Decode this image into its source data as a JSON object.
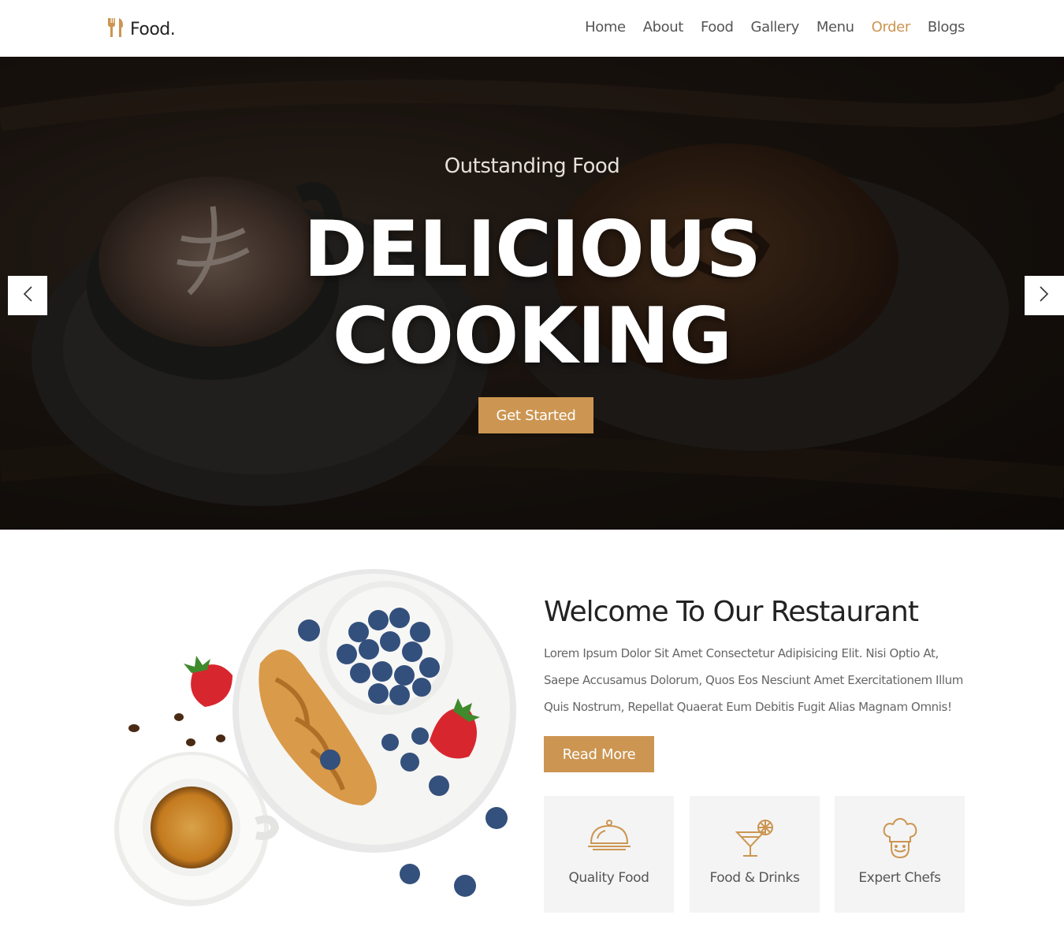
{
  "brand": {
    "name": "Food.",
    "icon": "fork-spoon-icon",
    "accent": "#cc9551"
  },
  "nav": {
    "items": [
      {
        "label": "Home"
      },
      {
        "label": "About"
      },
      {
        "label": "Food"
      },
      {
        "label": "Gallery"
      },
      {
        "label": "Menu"
      },
      {
        "label": "Order",
        "active": true
      },
      {
        "label": "Blogs"
      }
    ]
  },
  "hero": {
    "subtitle": "Outstanding Food",
    "title_line1": "DELICIOUS",
    "title_line2": "COOKING",
    "cta": "Get Started",
    "prev_icon": "chevron-left-icon",
    "next_icon": "chevron-right-icon"
  },
  "about": {
    "title": "Welcome To Our Restaurant",
    "text": "Lorem Ipsum Dolor Sit Amet Consectetur Adipisicing Elit. Nisi Optio At, Saepe Accusamus Dolorum, Quos Eos Nesciunt Amet Exercitationem Illum Quis Nostrum, Repellat Quaerat Eum Debitis Fugit Alias Magnam Omnis!",
    "button": "Read More",
    "features": [
      {
        "label": "Quality Food",
        "icon": "cloche-icon"
      },
      {
        "label": "Food & Drinks",
        "icon": "cocktail-icon"
      },
      {
        "label": "Expert Chefs",
        "icon": "chef-hat-icon"
      }
    ]
  }
}
